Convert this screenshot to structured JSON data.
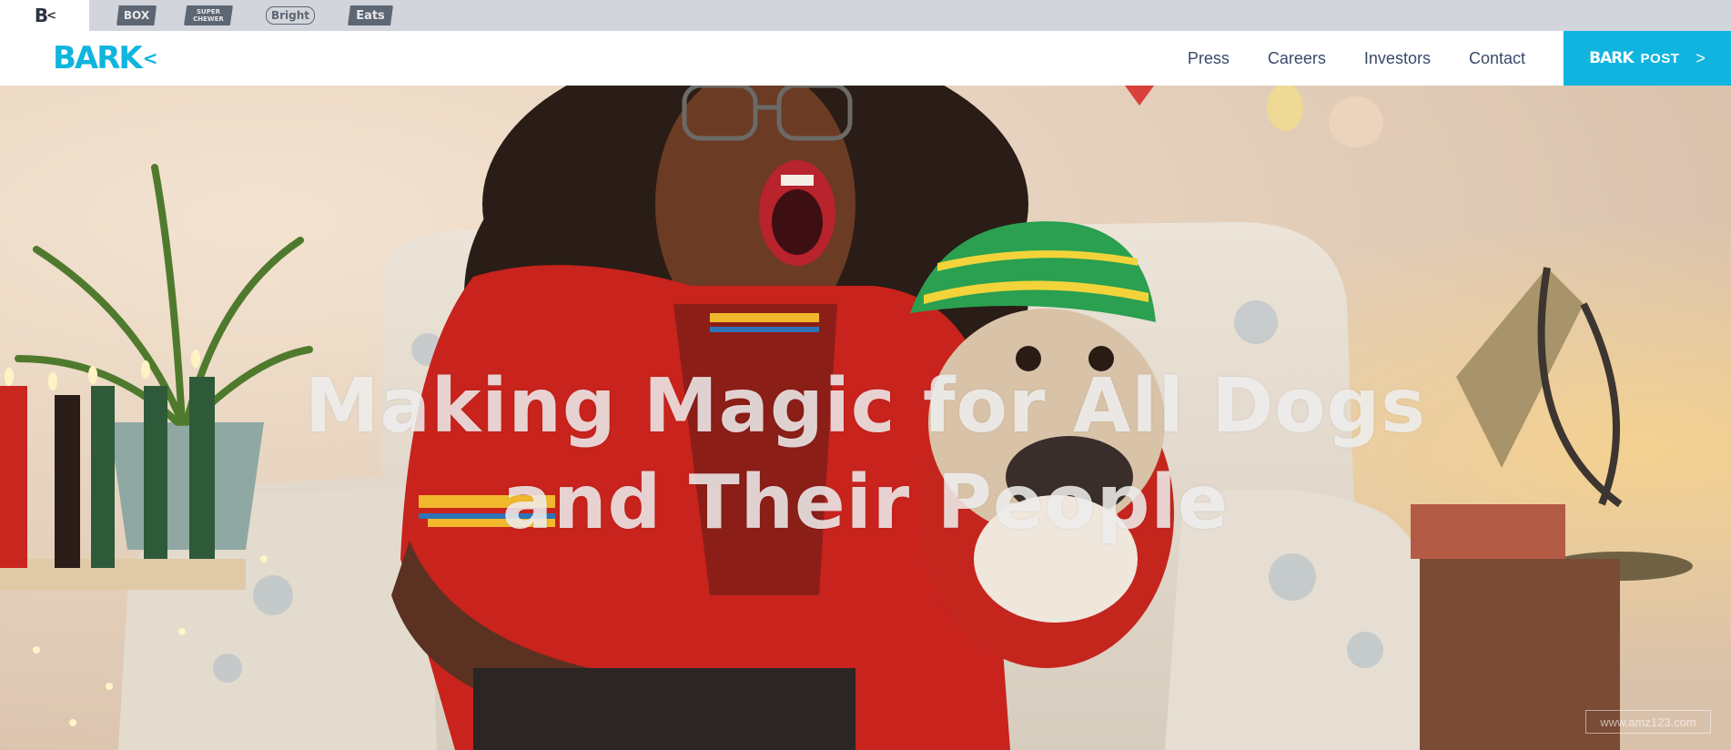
{
  "brand_strip": {
    "tabs": [
      {
        "label": "B",
        "sub": "<",
        "active": true
      },
      {
        "label": "BOX"
      },
      {
        "label_top": "SUPER",
        "label_bottom": "CHEWER"
      },
      {
        "label": "Bright"
      },
      {
        "label": "Eats"
      }
    ]
  },
  "header": {
    "logo": "BARK",
    "nav": [
      {
        "label": "Press"
      },
      {
        "label": "Careers"
      },
      {
        "label": "Investors"
      },
      {
        "label": "Contact"
      }
    ],
    "post_button": {
      "brand": "BARK",
      "label": "POST",
      "chevron": ">"
    }
  },
  "hero": {
    "title_line1": "Making Magic for All Dogs",
    "title_line2": "and Their People",
    "watermark": "www.amz123.com"
  },
  "colors": {
    "brand_blue": "#0fb5de",
    "nav_text": "#3a4a6b",
    "strip_bg": "#d2d5db"
  }
}
